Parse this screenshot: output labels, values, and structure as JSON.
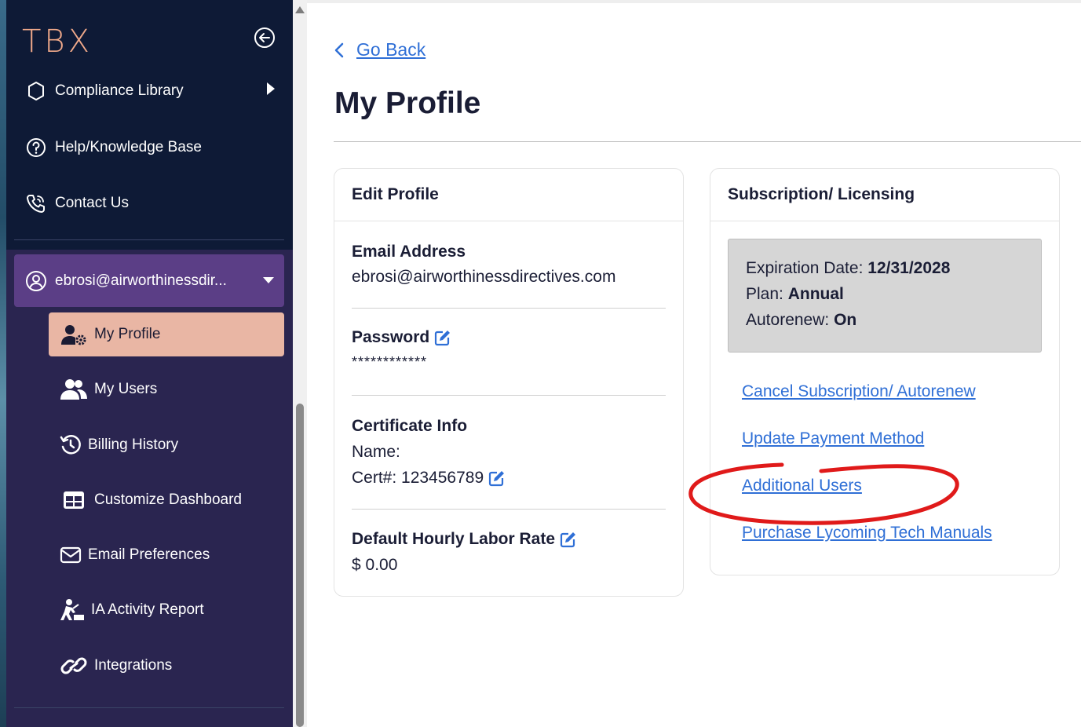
{
  "sidebar": {
    "logo": "TBX",
    "nav": [
      {
        "label": "Compliance Library",
        "icon": "hexagon-icon"
      },
      {
        "label": "Help/Knowledge Base",
        "icon": "question-circle-icon"
      },
      {
        "label": "Contact Us",
        "icon": "phone-icon"
      }
    ],
    "account": {
      "email": "ebrosi@airworthinessdir...",
      "icon": "user-circle-icon"
    },
    "sub_items": [
      {
        "label": "My Profile",
        "icon": "user-gear-icon",
        "active": true
      },
      {
        "label": "My Users",
        "icon": "users-icon"
      },
      {
        "label": "Billing History",
        "icon": "history-icon"
      },
      {
        "label": "Customize Dashboard",
        "icon": "grid-icon"
      },
      {
        "label": "Email Preferences",
        "icon": "envelope-icon"
      },
      {
        "label": "IA Activity Report",
        "icon": "worker-icon"
      },
      {
        "label": "Integrations",
        "icon": "link-icon"
      }
    ],
    "colors": {
      "sidebar_bg": "#0e1a36",
      "submenu_bg": "#2a2550",
      "account_bg": "#5b3e86",
      "active_bg": "#e9b6a4",
      "logo": "#f0a98a"
    }
  },
  "main": {
    "go_back": "Go Back",
    "title": "My Profile",
    "edit_profile": {
      "heading": "Edit Profile",
      "email_label": "Email Address",
      "email_value": "ebrosi@airworthinessdirectives.com",
      "password_label": "Password",
      "password_value": "************",
      "cert_label": "Certificate Info",
      "cert_name": "Name:",
      "cert_number": "Cert#: 123456789",
      "labor_label": "Default Hourly Labor Rate",
      "labor_value": "$ 0.00"
    },
    "subscription": {
      "heading": "Subscription/ Licensing",
      "expiration_label": "Expiration Date:",
      "expiration_value": "12/31/2028",
      "plan_label": "Plan:",
      "plan_value": "Annual",
      "autorenew_label": "Autorenew:",
      "autorenew_value": "On",
      "links": [
        "Cancel Subscription/ Autorenew",
        "Update Payment Method",
        "Additional Users",
        "Purchase Lycoming Tech Manuals"
      ]
    },
    "colors": {
      "link": "#2f6fd6",
      "annotation": "#e01a1a"
    }
  }
}
